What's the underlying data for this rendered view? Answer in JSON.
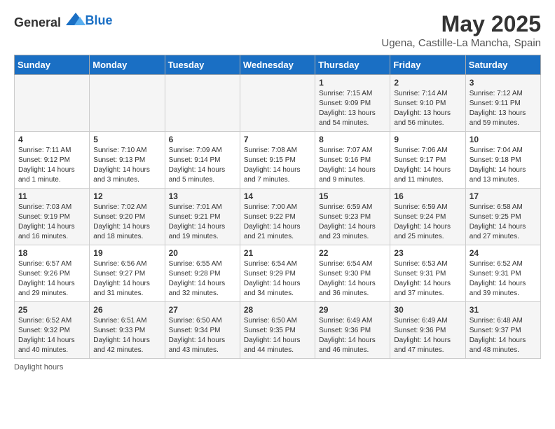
{
  "logo": {
    "general": "General",
    "blue": "Blue"
  },
  "title": "May 2025",
  "subtitle": "Ugena, Castille-La Mancha, Spain",
  "days_of_week": [
    "Sunday",
    "Monday",
    "Tuesday",
    "Wednesday",
    "Thursday",
    "Friday",
    "Saturday"
  ],
  "weeks": [
    [
      {
        "day": "",
        "info": ""
      },
      {
        "day": "",
        "info": ""
      },
      {
        "day": "",
        "info": ""
      },
      {
        "day": "",
        "info": ""
      },
      {
        "day": "1",
        "info": "Sunrise: 7:15 AM\nSunset: 9:09 PM\nDaylight: 13 hours\nand 54 minutes."
      },
      {
        "day": "2",
        "info": "Sunrise: 7:14 AM\nSunset: 9:10 PM\nDaylight: 13 hours\nand 56 minutes."
      },
      {
        "day": "3",
        "info": "Sunrise: 7:12 AM\nSunset: 9:11 PM\nDaylight: 13 hours\nand 59 minutes."
      }
    ],
    [
      {
        "day": "4",
        "info": "Sunrise: 7:11 AM\nSunset: 9:12 PM\nDaylight: 14 hours\nand 1 minute."
      },
      {
        "day": "5",
        "info": "Sunrise: 7:10 AM\nSunset: 9:13 PM\nDaylight: 14 hours\nand 3 minutes."
      },
      {
        "day": "6",
        "info": "Sunrise: 7:09 AM\nSunset: 9:14 PM\nDaylight: 14 hours\nand 5 minutes."
      },
      {
        "day": "7",
        "info": "Sunrise: 7:08 AM\nSunset: 9:15 PM\nDaylight: 14 hours\nand 7 minutes."
      },
      {
        "day": "8",
        "info": "Sunrise: 7:07 AM\nSunset: 9:16 PM\nDaylight: 14 hours\nand 9 minutes."
      },
      {
        "day": "9",
        "info": "Sunrise: 7:06 AM\nSunset: 9:17 PM\nDaylight: 14 hours\nand 11 minutes."
      },
      {
        "day": "10",
        "info": "Sunrise: 7:04 AM\nSunset: 9:18 PM\nDaylight: 14 hours\nand 13 minutes."
      }
    ],
    [
      {
        "day": "11",
        "info": "Sunrise: 7:03 AM\nSunset: 9:19 PM\nDaylight: 14 hours\nand 16 minutes."
      },
      {
        "day": "12",
        "info": "Sunrise: 7:02 AM\nSunset: 9:20 PM\nDaylight: 14 hours\nand 18 minutes."
      },
      {
        "day": "13",
        "info": "Sunrise: 7:01 AM\nSunset: 9:21 PM\nDaylight: 14 hours\nand 19 minutes."
      },
      {
        "day": "14",
        "info": "Sunrise: 7:00 AM\nSunset: 9:22 PM\nDaylight: 14 hours\nand 21 minutes."
      },
      {
        "day": "15",
        "info": "Sunrise: 6:59 AM\nSunset: 9:23 PM\nDaylight: 14 hours\nand 23 minutes."
      },
      {
        "day": "16",
        "info": "Sunrise: 6:59 AM\nSunset: 9:24 PM\nDaylight: 14 hours\nand 25 minutes."
      },
      {
        "day": "17",
        "info": "Sunrise: 6:58 AM\nSunset: 9:25 PM\nDaylight: 14 hours\nand 27 minutes."
      }
    ],
    [
      {
        "day": "18",
        "info": "Sunrise: 6:57 AM\nSunset: 9:26 PM\nDaylight: 14 hours\nand 29 minutes."
      },
      {
        "day": "19",
        "info": "Sunrise: 6:56 AM\nSunset: 9:27 PM\nDaylight: 14 hours\nand 31 minutes."
      },
      {
        "day": "20",
        "info": "Sunrise: 6:55 AM\nSunset: 9:28 PM\nDaylight: 14 hours\nand 32 minutes."
      },
      {
        "day": "21",
        "info": "Sunrise: 6:54 AM\nSunset: 9:29 PM\nDaylight: 14 hours\nand 34 minutes."
      },
      {
        "day": "22",
        "info": "Sunrise: 6:54 AM\nSunset: 9:30 PM\nDaylight: 14 hours\nand 36 minutes."
      },
      {
        "day": "23",
        "info": "Sunrise: 6:53 AM\nSunset: 9:31 PM\nDaylight: 14 hours\nand 37 minutes."
      },
      {
        "day": "24",
        "info": "Sunrise: 6:52 AM\nSunset: 9:31 PM\nDaylight: 14 hours\nand 39 minutes."
      }
    ],
    [
      {
        "day": "25",
        "info": "Sunrise: 6:52 AM\nSunset: 9:32 PM\nDaylight: 14 hours\nand 40 minutes."
      },
      {
        "day": "26",
        "info": "Sunrise: 6:51 AM\nSunset: 9:33 PM\nDaylight: 14 hours\nand 42 minutes."
      },
      {
        "day": "27",
        "info": "Sunrise: 6:50 AM\nSunset: 9:34 PM\nDaylight: 14 hours\nand 43 minutes."
      },
      {
        "day": "28",
        "info": "Sunrise: 6:50 AM\nSunset: 9:35 PM\nDaylight: 14 hours\nand 44 minutes."
      },
      {
        "day": "29",
        "info": "Sunrise: 6:49 AM\nSunset: 9:36 PM\nDaylight: 14 hours\nand 46 minutes."
      },
      {
        "day": "30",
        "info": "Sunrise: 6:49 AM\nSunset: 9:36 PM\nDaylight: 14 hours\nand 47 minutes."
      },
      {
        "day": "31",
        "info": "Sunrise: 6:48 AM\nSunset: 9:37 PM\nDaylight: 14 hours\nand 48 minutes."
      }
    ]
  ],
  "footer": "Daylight hours"
}
